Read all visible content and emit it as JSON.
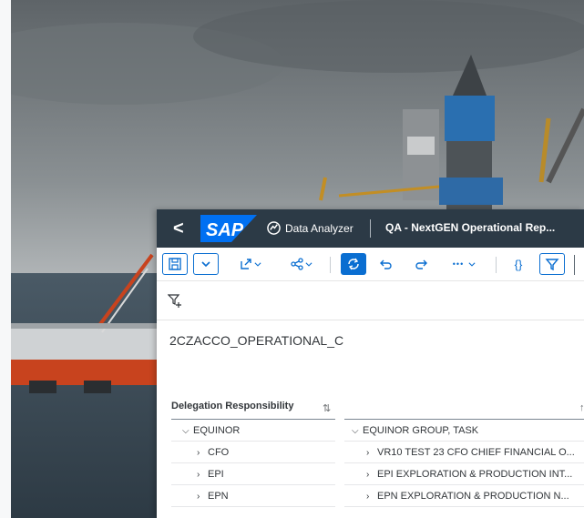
{
  "app": {
    "title": "Data Analyzer",
    "report_title": "QA - NextGEN Operational Rep...",
    "back_glyph": "<",
    "logo_text": "SAP"
  },
  "toolbar": {
    "more_glyph": "•••",
    "curly_label": "{}"
  },
  "dataset": {
    "name": "2CZACCO_OPERATIONAL_C"
  },
  "table": {
    "col1_header": "Delegation Responsibility",
    "col2_header": "",
    "rows": [
      {
        "left": "EQUINOR",
        "right": "EQUINOR GROUP, TASK",
        "level": 0
      },
      {
        "left": "CFO",
        "right": "VR10 TEST 23 CFO CHIEF FINANCIAL O...",
        "level": 1
      },
      {
        "left": "EPI",
        "right": "EPI EXPLORATION & PRODUCTION INT...",
        "level": 1
      },
      {
        "left": "EPN",
        "right": "EPN EXPLORATION & PRODUCTION N...",
        "level": 1
      }
    ]
  },
  "colors": {
    "shell": "#2c3a46",
    "accent": "#0a6ed1",
    "logo_blue": "#0070f2"
  }
}
